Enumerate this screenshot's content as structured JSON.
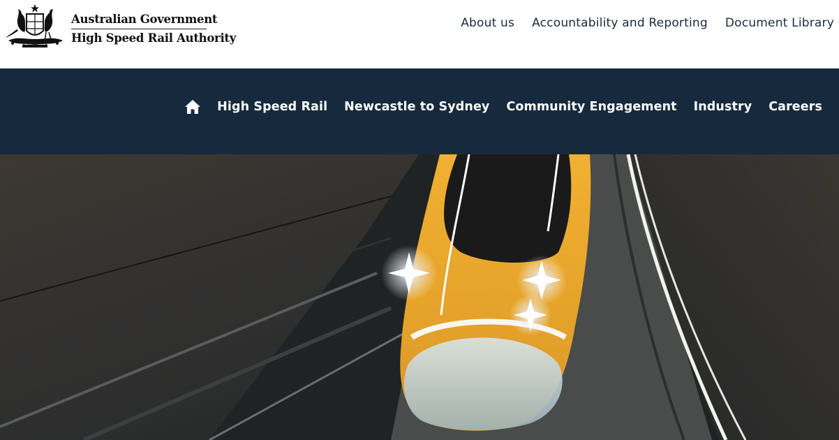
{
  "logo": {
    "line1": "Australian Government",
    "line2": "High Speed Rail Authority"
  },
  "utility_nav": [
    {
      "label": "About us"
    },
    {
      "label": "Accountability and Reporting"
    },
    {
      "label": "Document Library"
    }
  ],
  "main_nav": {
    "home_icon": "home-icon",
    "items": [
      {
        "label": "High Speed Rail"
      },
      {
        "label": "Newcastle to Sydney"
      },
      {
        "label": "Community Engagement"
      },
      {
        "label": "Industry"
      },
      {
        "label": "Careers"
      }
    ]
  },
  "colors": {
    "nav_background": "#172a3d",
    "train_yellow": "#e8a72a"
  }
}
